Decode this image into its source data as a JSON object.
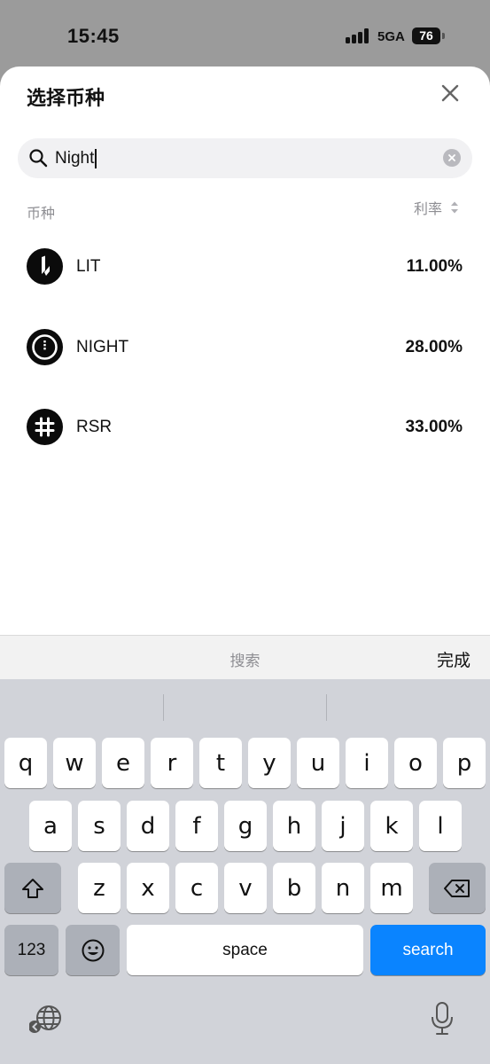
{
  "status_bar": {
    "time": "15:45",
    "network": "5GA",
    "battery": "76"
  },
  "sheet": {
    "title": "选择币种",
    "search": {
      "value": "Night"
    },
    "columns": {
      "coin": "币种",
      "rate": "利率"
    },
    "coins": [
      {
        "name": "LIT",
        "rate": "11.00%",
        "icon": "lit-logo"
      },
      {
        "name": "NIGHT",
        "rate": "28.00%",
        "icon": "night-logo"
      },
      {
        "name": "RSR",
        "rate": "33.00%",
        "icon": "rsr-logo"
      }
    ]
  },
  "accessory": {
    "label": "搜索",
    "done": "完成"
  },
  "keyboard": {
    "row1": [
      "q",
      "w",
      "e",
      "r",
      "t",
      "y",
      "u",
      "i",
      "o",
      "p"
    ],
    "row2": [
      "a",
      "s",
      "d",
      "f",
      "g",
      "h",
      "j",
      "k",
      "l"
    ],
    "row3": [
      "z",
      "x",
      "c",
      "v",
      "b",
      "n",
      "m"
    ],
    "numbers_key": "123",
    "space_key": "space",
    "search_key": "search"
  },
  "colors": {
    "accent_blue": "#0a84ff",
    "keyboard_bg": "#d1d3d9",
    "overlay": "#9b9b9b"
  }
}
